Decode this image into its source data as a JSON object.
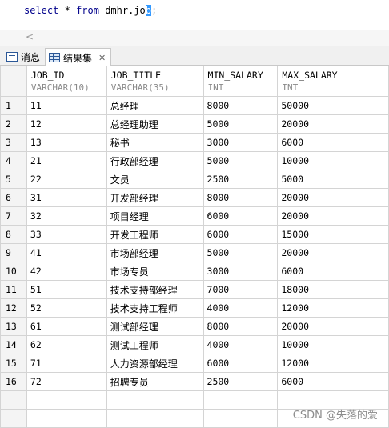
{
  "editor": {
    "kw_select": "select",
    "star": "*",
    "kw_from": "from",
    "table_prefix": "dmhr.jo",
    "table_selected": "b",
    "semicolon": ";"
  },
  "scroll_arrow": "<",
  "tabs": {
    "messages": "消息",
    "results": "结果集",
    "close": "✕"
  },
  "grid": {
    "columns": [
      {
        "name": "JOB_ID",
        "type": "VARCHAR(10)"
      },
      {
        "name": "JOB_TITLE",
        "type": "VARCHAR(35)"
      },
      {
        "name": "MIN_SALARY",
        "type": "INT"
      },
      {
        "name": "MAX_SALARY",
        "type": "INT"
      }
    ],
    "rows": [
      [
        "1",
        "11",
        "总经理",
        "8000",
        "50000"
      ],
      [
        "2",
        "12",
        "总经理助理",
        "5000",
        "20000"
      ],
      [
        "3",
        "13",
        "秘书",
        "3000",
        "6000"
      ],
      [
        "4",
        "21",
        "行政部经理",
        "5000",
        "10000"
      ],
      [
        "5",
        "22",
        "文员",
        "2500",
        "5000"
      ],
      [
        "6",
        "31",
        "开发部经理",
        "8000",
        "20000"
      ],
      [
        "7",
        "32",
        "项目经理",
        "6000",
        "20000"
      ],
      [
        "8",
        "33",
        "开发工程师",
        "6000",
        "15000"
      ],
      [
        "9",
        "41",
        "市场部经理",
        "5000",
        "20000"
      ],
      [
        "10",
        "42",
        "市场专员",
        "3000",
        "6000"
      ],
      [
        "11",
        "51",
        "技术支持部经理",
        "7000",
        "18000"
      ],
      [
        "12",
        "52",
        "技术支持工程师",
        "4000",
        "12000"
      ],
      [
        "13",
        "61",
        "测试部经理",
        "8000",
        "20000"
      ],
      [
        "14",
        "62",
        "测试工程师",
        "4000",
        "10000"
      ],
      [
        "15",
        "71",
        "人力资源部经理",
        "6000",
        "12000"
      ],
      [
        "16",
        "72",
        "招聘专员",
        "2500",
        "6000"
      ]
    ]
  },
  "watermark": "CSDN @失落的爱"
}
